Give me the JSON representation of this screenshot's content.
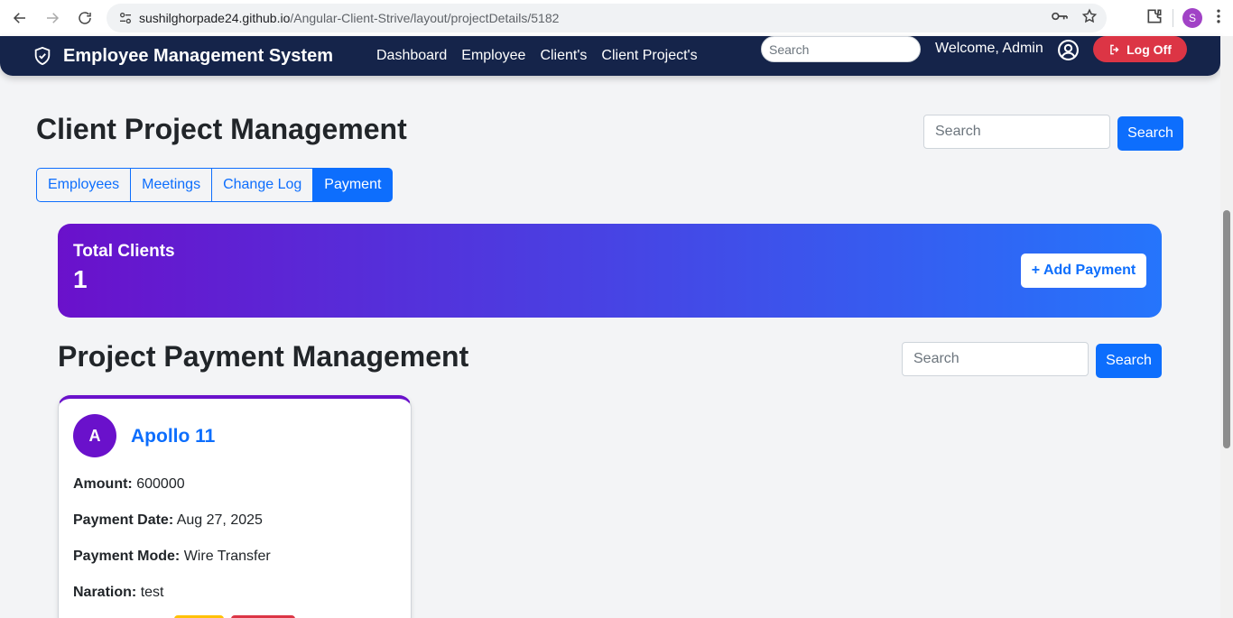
{
  "browser": {
    "url_host": "sushilghorpade24.github.io",
    "url_path": "/Angular-Client-Strive/layout/projectDetails/5182",
    "profile_initial": "S"
  },
  "navbar": {
    "brand": "Employee Management System",
    "links": [
      "Dashboard",
      "Employee",
      "Client's",
      "Client Project's"
    ],
    "search_placeholder": "Search",
    "welcome": "Welcome, Admin",
    "logoff": "Log Off"
  },
  "page": {
    "title": "Client Project Management",
    "search_placeholder": "Search",
    "search_button": "Search",
    "tabs": [
      {
        "label": "Employees",
        "active": false
      },
      {
        "label": "Meetings",
        "active": false
      },
      {
        "label": "Change Log",
        "active": false
      },
      {
        "label": "Payment",
        "active": true
      }
    ]
  },
  "banner": {
    "label": "Total Clients",
    "count": "1",
    "add_button": "+ Add Payment"
  },
  "section": {
    "title": "Project Payment Management",
    "search_placeholder": "Search",
    "search_button": "Search"
  },
  "payments": [
    {
      "avatar": "A",
      "name": "Apollo 11",
      "amount_label": "Amount:",
      "amount": "600000",
      "date_label": "Payment Date:",
      "date": "Aug 27, 2025",
      "mode_label": "Payment Mode:",
      "mode": "Wire Transfer",
      "naration_label": "Naration:",
      "naration": "test"
    }
  ],
  "colors": {
    "navbar": "#15244a",
    "primary": "#0d6efd",
    "danger": "#dc3545",
    "warning": "#ffc107",
    "gradient_start": "#6a11cb",
    "gradient_end": "#2575fc"
  }
}
